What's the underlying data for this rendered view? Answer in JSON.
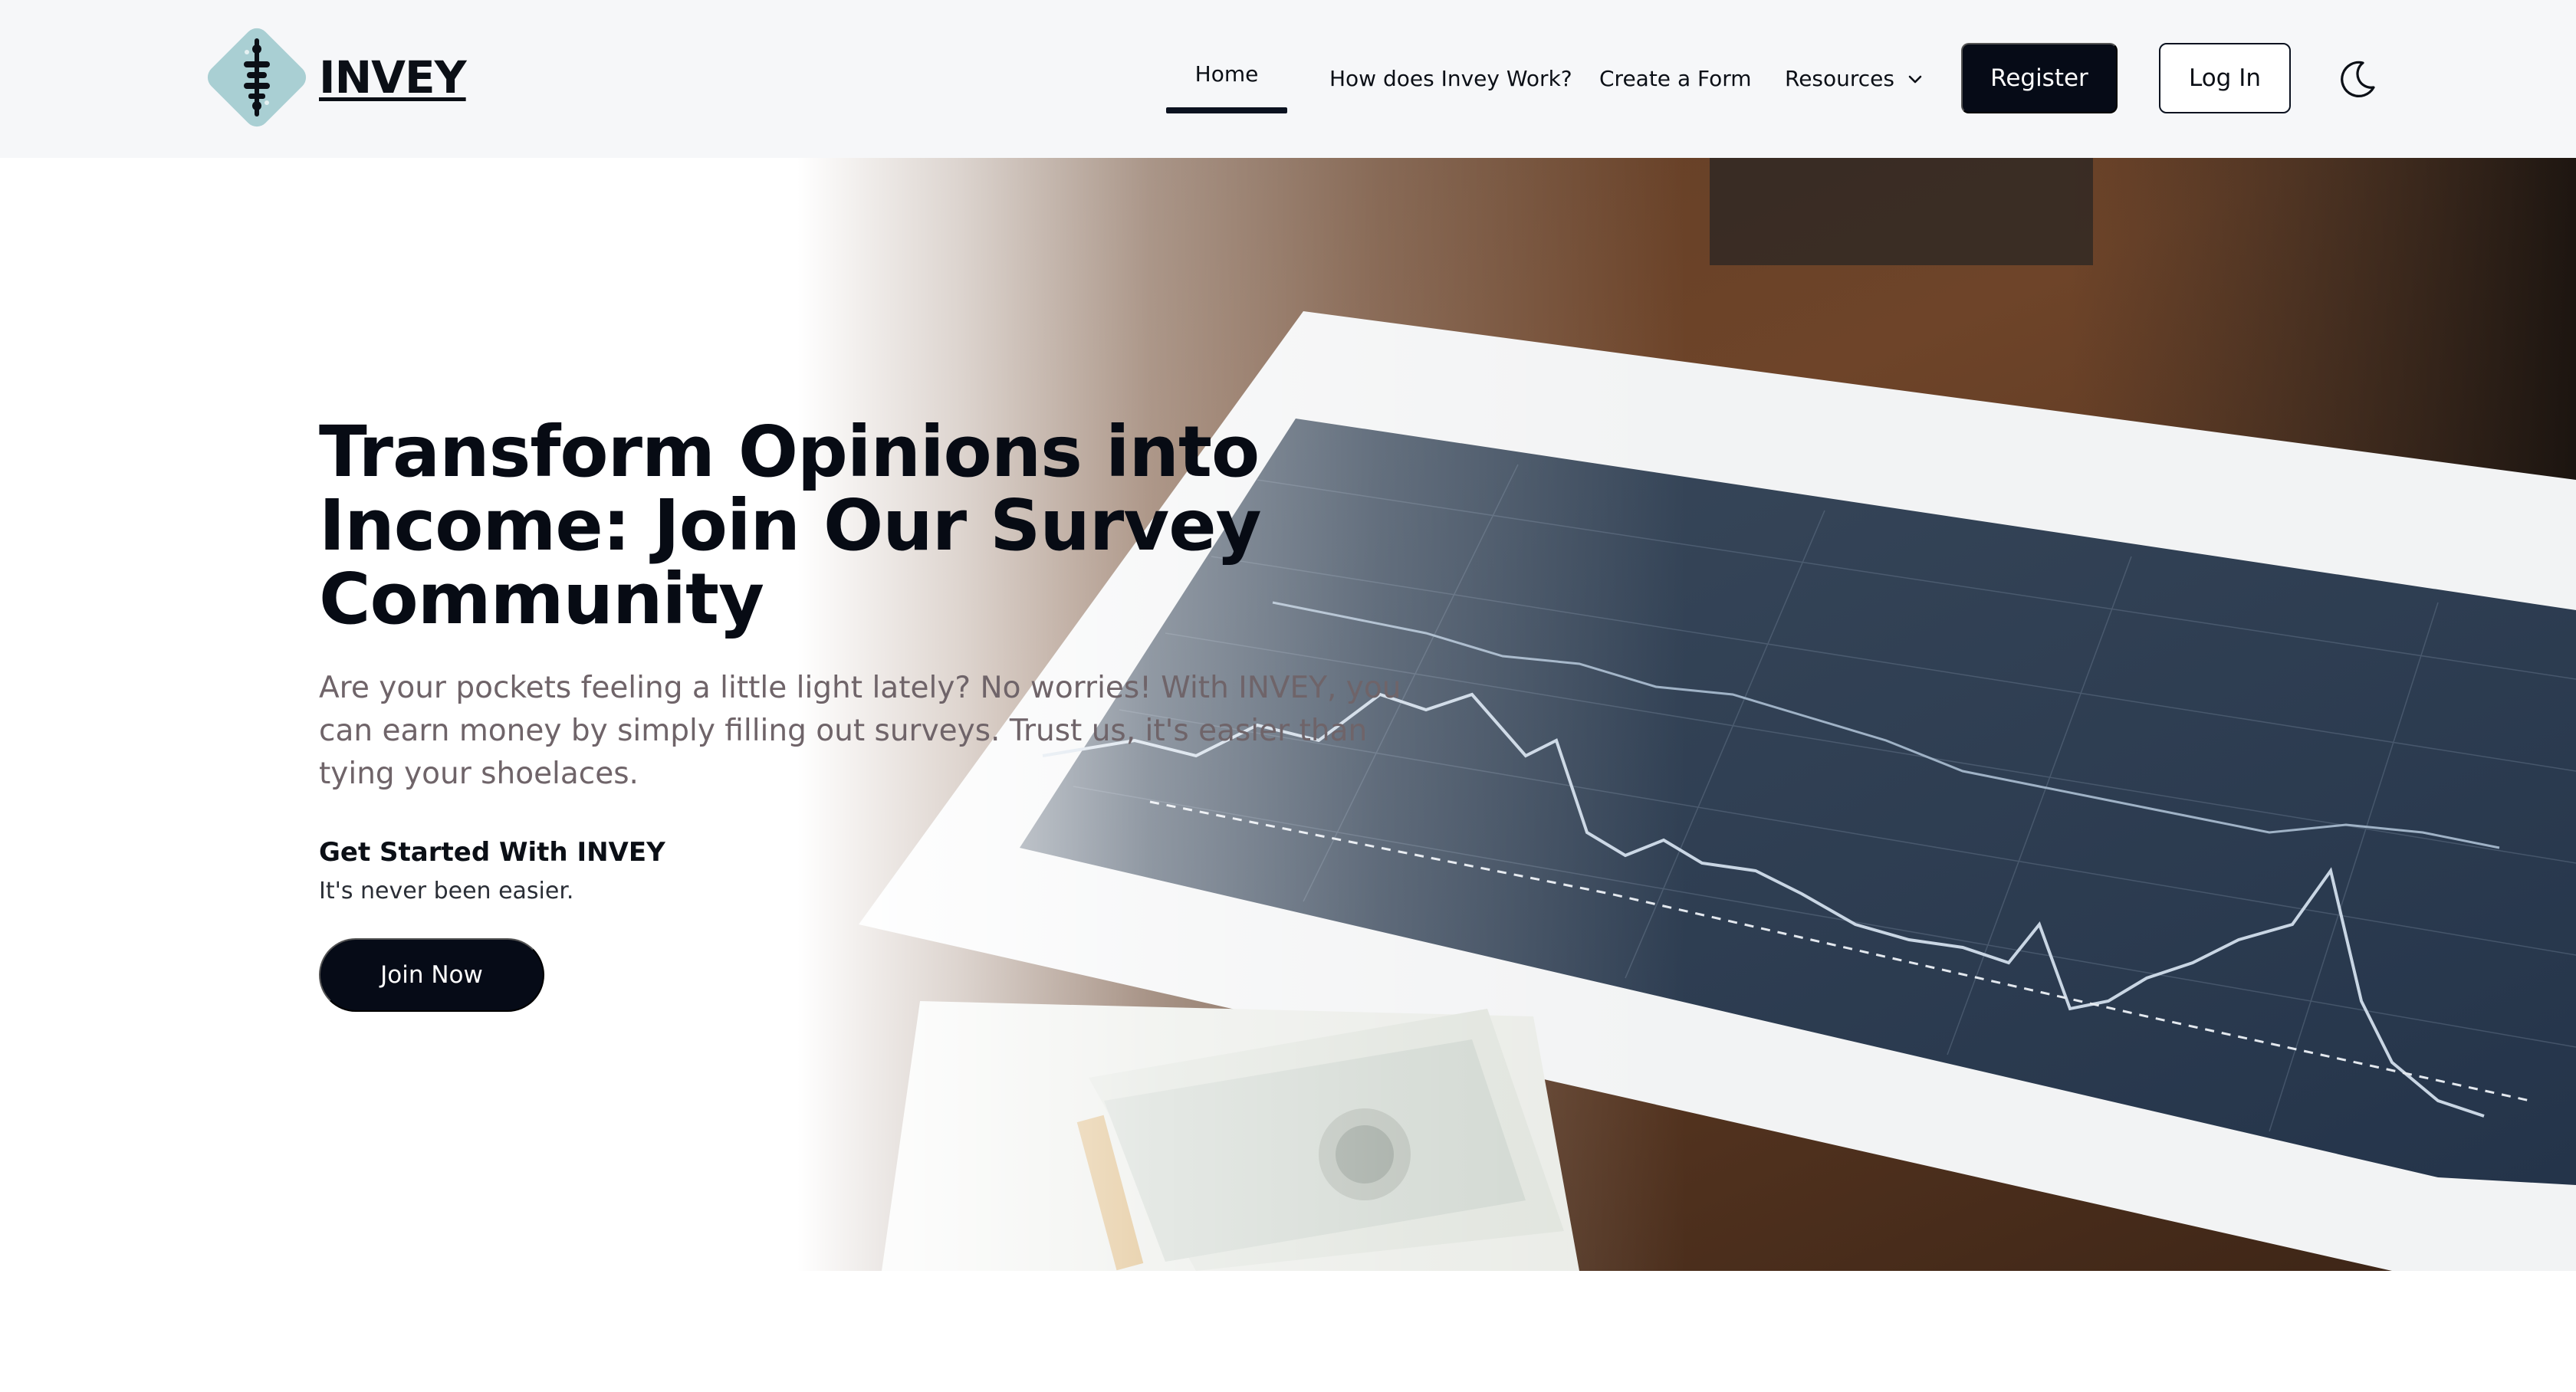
{
  "brand": {
    "name": "INVEY"
  },
  "nav": {
    "items": [
      {
        "label": "Home",
        "active": true
      },
      {
        "label": "How does Invey Work?"
      },
      {
        "label": "Create a Form"
      },
      {
        "label": "Resources",
        "has_dropdown": true
      }
    ],
    "register_label": "Register",
    "login_label": "Log In",
    "theme_toggle_icon": "moon-icon"
  },
  "hero": {
    "title": "Transform Opinions into Income: Join Our Survey Community",
    "description": "Are your pockets feeling a little light lately? No worries! With INVEY, you can earn money by simply filling out surveys. Trust us, it's easier than tying your shoelaces.",
    "subheading": "Get Started With INVEY",
    "subtext": "It's never been easier.",
    "cta_label": "Join Now",
    "background_icon": "stock-chart-and-cash-photo"
  },
  "colors": {
    "primary": "#060b17",
    "nav_background": "#f6f7f9",
    "description_text": "#6f6469",
    "logo_accent": "#a9cfd3"
  }
}
